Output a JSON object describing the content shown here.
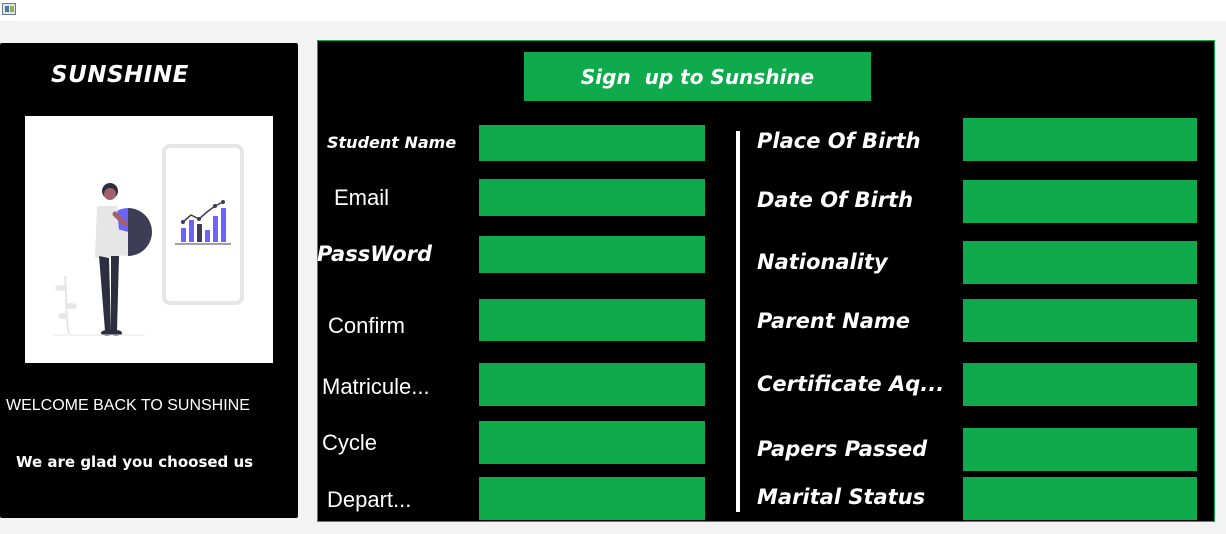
{
  "left_panel": {
    "brand": "SUNSHINE",
    "welcome": "WELCOME BACK TO SUNSHINE",
    "glad": "We are glad you choosed us"
  },
  "form": {
    "title": "Sign  up to Sunshine",
    "left_fields": [
      {
        "label": "Student Name",
        "value": ""
      },
      {
        "label": "Email",
        "value": ""
      },
      {
        "label": "PassWord",
        "value": ""
      },
      {
        "label": "Confirm",
        "value": ""
      },
      {
        "label": "Matricule...",
        "value": ""
      },
      {
        "label": "Cycle",
        "value": ""
      },
      {
        "label": "Depart...",
        "value": ""
      }
    ],
    "right_fields": [
      {
        "label": "Place Of Birth",
        "value": ""
      },
      {
        "label": "Date Of Birth",
        "value": ""
      },
      {
        "label": "Nationality",
        "value": ""
      },
      {
        "label": "Parent Name",
        "value": ""
      },
      {
        "label": "Certificate Aq...",
        "value": ""
      },
      {
        "label": "Papers Passed",
        "value": ""
      },
      {
        "label": "Marital Status",
        "value": ""
      }
    ]
  },
  "colors": {
    "accent": "#0eaa4c",
    "panel": "#000000",
    "illustration_purple": "#6c63ff"
  },
  "icons": [
    "app-icon",
    "person-chart-illustration"
  ]
}
